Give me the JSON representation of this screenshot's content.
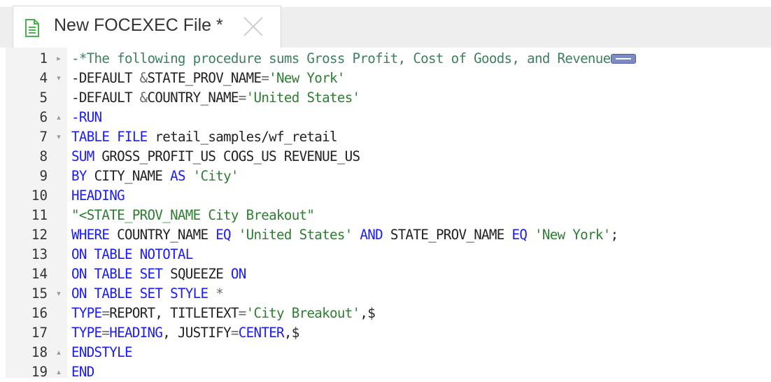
{
  "tab": {
    "title": "New FOCEXEC File *",
    "icon": "document-icon",
    "close_icon": "close-icon"
  },
  "colors": {
    "keyword": "#1a1aff",
    "string": "#2e7d32",
    "comment": "#3f7f5f",
    "plain": "#222222",
    "gutter": "#f3f3f3"
  },
  "editor": {
    "lines": [
      {
        "num": "1",
        "fold": "▸",
        "tokens": [
          {
            "t": "cmt",
            "v": "-*The following procedure sums Gross Profit, Cost of Goods, and Revenue"
          }
        ],
        "folded": true
      },
      {
        "num": "4",
        "fold": "▾",
        "tokens": [
          {
            "t": "plain",
            "v": "-DEFAULT "
          },
          {
            "t": "op",
            "v": "&"
          },
          {
            "t": "plain",
            "v": "STATE_PROV_NAME"
          },
          {
            "t": "op",
            "v": "="
          },
          {
            "t": "str",
            "v": "'New York'"
          }
        ]
      },
      {
        "num": "5",
        "fold": "",
        "tokens": [
          {
            "t": "plain",
            "v": "-DEFAULT "
          },
          {
            "t": "op",
            "v": "&"
          },
          {
            "t": "plain",
            "v": "COUNTRY_NAME"
          },
          {
            "t": "op",
            "v": "="
          },
          {
            "t": "str",
            "v": "'United States'"
          }
        ]
      },
      {
        "num": "6",
        "fold": "▴",
        "tokens": [
          {
            "t": "kw",
            "v": "-RUN"
          }
        ]
      },
      {
        "num": "7",
        "fold": "▾",
        "tokens": [
          {
            "t": "kw",
            "v": "TABLE FILE"
          },
          {
            "t": "plain",
            "v": " retail_samples/wf_retail"
          }
        ]
      },
      {
        "num": "8",
        "fold": "",
        "tokens": [
          {
            "t": "kw",
            "v": "SUM"
          },
          {
            "t": "plain",
            "v": " GROSS_PROFIT_US COGS_US REVENUE_US"
          }
        ]
      },
      {
        "num": "9",
        "fold": "",
        "tokens": [
          {
            "t": "kw",
            "v": "BY"
          },
          {
            "t": "plain",
            "v": " CITY_NAME "
          },
          {
            "t": "kw",
            "v": "AS"
          },
          {
            "t": "plain",
            "v": " "
          },
          {
            "t": "str",
            "v": "'City'"
          }
        ]
      },
      {
        "num": "10",
        "fold": "",
        "tokens": [
          {
            "t": "kw",
            "v": "HEADING"
          }
        ]
      },
      {
        "num": "11",
        "fold": "",
        "tokens": [
          {
            "t": "str",
            "v": "\"<STATE_PROV_NAME City Breakout\""
          }
        ]
      },
      {
        "num": "12",
        "fold": "",
        "tokens": [
          {
            "t": "kw",
            "v": "WHERE"
          },
          {
            "t": "plain",
            "v": " COUNTRY_NAME "
          },
          {
            "t": "kw",
            "v": "EQ"
          },
          {
            "t": "plain",
            "v": " "
          },
          {
            "t": "str",
            "v": "'United States'"
          },
          {
            "t": "plain",
            "v": " "
          },
          {
            "t": "kw",
            "v": "AND"
          },
          {
            "t": "plain",
            "v": " STATE_PROV_NAME "
          },
          {
            "t": "kw",
            "v": "EQ"
          },
          {
            "t": "plain",
            "v": " "
          },
          {
            "t": "str",
            "v": "'New York'"
          },
          {
            "t": "plain",
            "v": ";"
          }
        ]
      },
      {
        "num": "13",
        "fold": "",
        "tokens": [
          {
            "t": "kw",
            "v": "ON TABLE NOTOTAL"
          }
        ]
      },
      {
        "num": "14",
        "fold": "",
        "tokens": [
          {
            "t": "kw",
            "v": "ON TABLE SET"
          },
          {
            "t": "plain",
            "v": " SQUEEZE "
          },
          {
            "t": "kw",
            "v": "ON"
          }
        ]
      },
      {
        "num": "15",
        "fold": "▾",
        "tokens": [
          {
            "t": "kw",
            "v": "ON TABLE SET STYLE"
          },
          {
            "t": "plain",
            "v": " "
          },
          {
            "t": "op",
            "v": "*"
          }
        ]
      },
      {
        "num": "16",
        "fold": "",
        "tokens": [
          {
            "t": "kw",
            "v": "TYPE"
          },
          {
            "t": "op",
            "v": "="
          },
          {
            "t": "plain",
            "v": "REPORT, TITLETEXT"
          },
          {
            "t": "op",
            "v": "="
          },
          {
            "t": "str",
            "v": "'City Breakout'"
          },
          {
            "t": "plain",
            "v": ",$"
          }
        ]
      },
      {
        "num": "17",
        "fold": "",
        "tokens": [
          {
            "t": "kw",
            "v": "TYPE"
          },
          {
            "t": "op",
            "v": "="
          },
          {
            "t": "kw",
            "v": "HEADING"
          },
          {
            "t": "plain",
            "v": ", JUSTIFY"
          },
          {
            "t": "op",
            "v": "="
          },
          {
            "t": "kw",
            "v": "CENTER"
          },
          {
            "t": "plain",
            "v": ",$"
          }
        ]
      },
      {
        "num": "18",
        "fold": "▴",
        "tokens": [
          {
            "t": "kw",
            "v": "ENDSTYLE"
          }
        ]
      },
      {
        "num": "19",
        "fold": "▴",
        "tokens": [
          {
            "t": "kw",
            "v": "END"
          }
        ]
      }
    ]
  }
}
